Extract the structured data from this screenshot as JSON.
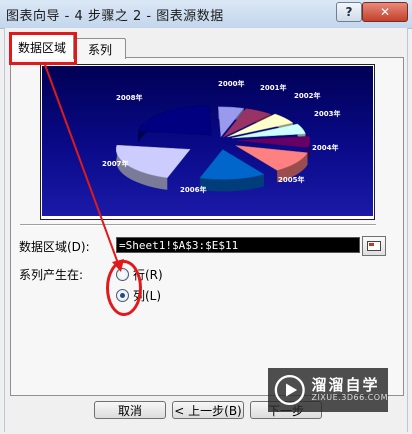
{
  "window": {
    "title": "图表向导 - 4 步骤之 2 - 图表源数据",
    "help_label": "?",
    "close_label": "✕"
  },
  "tabs": [
    {
      "label": "数据区域",
      "active": true
    },
    {
      "label": "系列",
      "active": false
    }
  ],
  "chart_data": {
    "type": "pie",
    "style": "exploded 3d pie",
    "categories": [
      "2000年",
      "2001年",
      "2002年",
      "2003年",
      "2004年",
      "2005年",
      "2006年",
      "2007年",
      "2008年"
    ],
    "colors": [
      "#9999ee",
      "#993366",
      "#ffffcc",
      "#ccffff",
      "#660066",
      "#ff8080",
      "#0066cc",
      "#ccccff",
      "#000080"
    ],
    "background": "#0a0a6e"
  },
  "form": {
    "range_label": "数据区域(D):",
    "range_value": "=Sheet1!$A$3:$E$11",
    "series_in_label": "系列产生在:",
    "options": [
      {
        "label": "行(R)",
        "checked": false
      },
      {
        "label": "列(L)",
        "checked": true
      }
    ]
  },
  "buttons": {
    "cancel": "取消",
    "back": "< 上一步(B)",
    "next": "下一步"
  },
  "watermark": {
    "name": "溜溜自学",
    "url": "ZIXUE.3D66.COM"
  },
  "colors": {
    "highlight": "#e01a1a"
  }
}
